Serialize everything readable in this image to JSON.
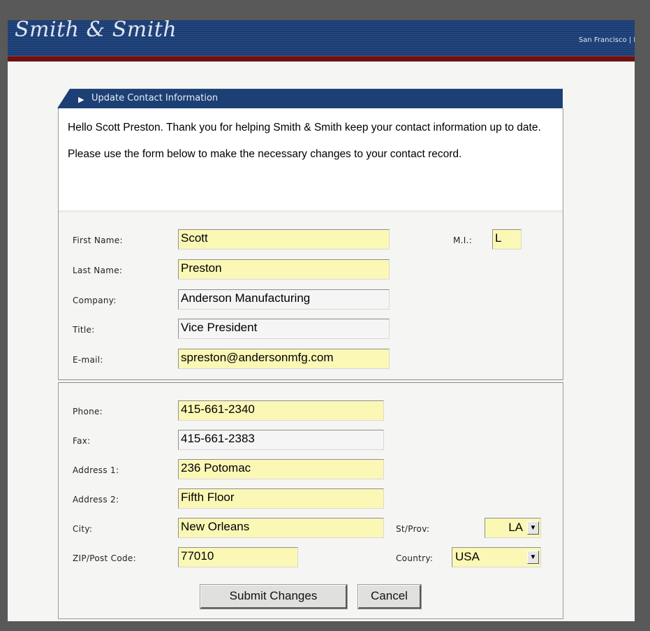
{
  "header": {
    "logo_text": "Smith & Smith",
    "nav_text": "San Francisco | D"
  },
  "panel": {
    "title": "Update Contact Information",
    "intro": {
      "line1": "Hello Scott Preston.  Thank you for helping Smith & Smith keep your contact information up to date.",
      "line2": "Please use the form below to make the necessary changes to your contact record."
    }
  },
  "form": {
    "first_name": {
      "label": "First Name:",
      "value": "Scott"
    },
    "mi": {
      "label": "M.I.:",
      "value": "L"
    },
    "last_name": {
      "label": "Last Name:",
      "value": "Preston"
    },
    "company": {
      "label": "Company:",
      "value": "Anderson Manufacturing"
    },
    "title": {
      "label": "Title:",
      "value": "Vice President"
    },
    "email": {
      "label": "E-mail:",
      "value": "spreston@andersonmfg.com"
    },
    "phone": {
      "label": "Phone:",
      "value": "415-661-2340"
    },
    "fax": {
      "label": "Fax:",
      "value": "415-661-2383"
    },
    "address1": {
      "label": "Address 1:",
      "value": "236 Potomac"
    },
    "address2": {
      "label": "Address 2:",
      "value": "Fifth Floor"
    },
    "city": {
      "label": "City:",
      "value": "New Orleans"
    },
    "state": {
      "label": "St/Prov:",
      "value": "LA"
    },
    "zip": {
      "label": "ZIP/Post Code:",
      "value": "77010"
    },
    "country": {
      "label": "Country:",
      "value": "USA"
    }
  },
  "buttons": {
    "submit": "Submit Changes",
    "cancel": "Cancel"
  },
  "colors": {
    "header_blue": "#1a3b70",
    "accent_red": "#6b1212",
    "required_field": "#fbf8b6"
  }
}
